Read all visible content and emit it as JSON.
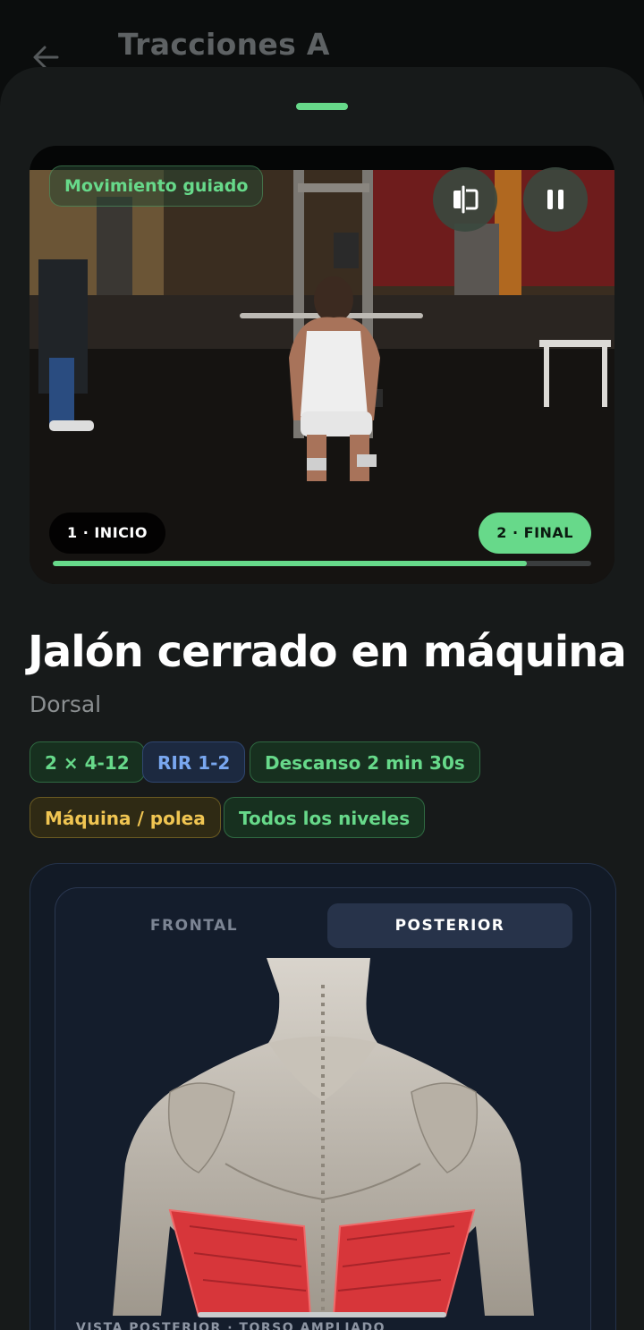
{
  "header": {
    "title": "Tracciones A",
    "back_icon": "arrow-left-icon"
  },
  "video": {
    "guided_badge": "Movimiento guiado",
    "compare_icon": "compare-split-icon",
    "pause_icon": "pause-icon",
    "phase_start": "1 · INICIO",
    "phase_end": "2 · FINAL",
    "progress": 0.88
  },
  "exercise": {
    "name": "Jalón cerrado en máquina",
    "muscle": "Dorsal",
    "tags": [
      {
        "label": "2 × 4-12",
        "style": "green"
      },
      {
        "label": "RIR 1-2",
        "style": "blue"
      },
      {
        "label": "Descanso 2 min 30s",
        "style": "green"
      },
      {
        "label": "Máquina / polea",
        "style": "yellow"
      },
      {
        "label": "Todos los niveles",
        "style": "green"
      }
    ]
  },
  "anatomy": {
    "tabs": [
      {
        "label": "FRONTAL",
        "active": false
      },
      {
        "label": "POSTERIOR",
        "active": true
      }
    ],
    "caption": "VISTA POSTERIOR · TORSO AMPLIADO",
    "highlight_color": "#d7363a"
  },
  "colors": {
    "accent": "#67d98a",
    "background": "#171a1a"
  }
}
